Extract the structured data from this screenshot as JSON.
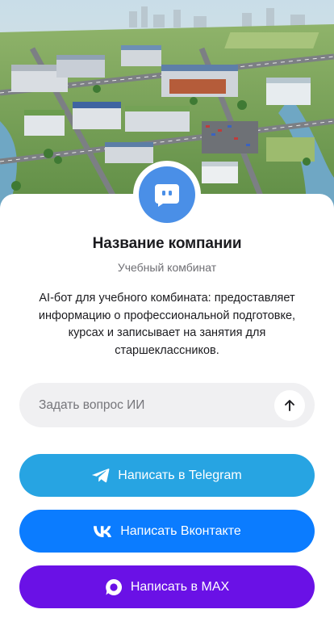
{
  "company": {
    "name": "Название компании",
    "subtitle": "Учебный комбинат",
    "description": "AI-бот для учебного комбината: предоставляет информацию о профессиональной подготовке, курсах и записывает на занятия для старшеклассников."
  },
  "ask": {
    "placeholder": "Задать вопрос ИИ"
  },
  "buttons": {
    "telegram": "Написать в Telegram",
    "vk": "Написать Вконтакте",
    "max": "Написать в MAX"
  },
  "colors": {
    "avatar": "#4a8fe7",
    "telegram": "#27a4e2",
    "vk": "#0b7cff",
    "max": "#6a11e6"
  }
}
